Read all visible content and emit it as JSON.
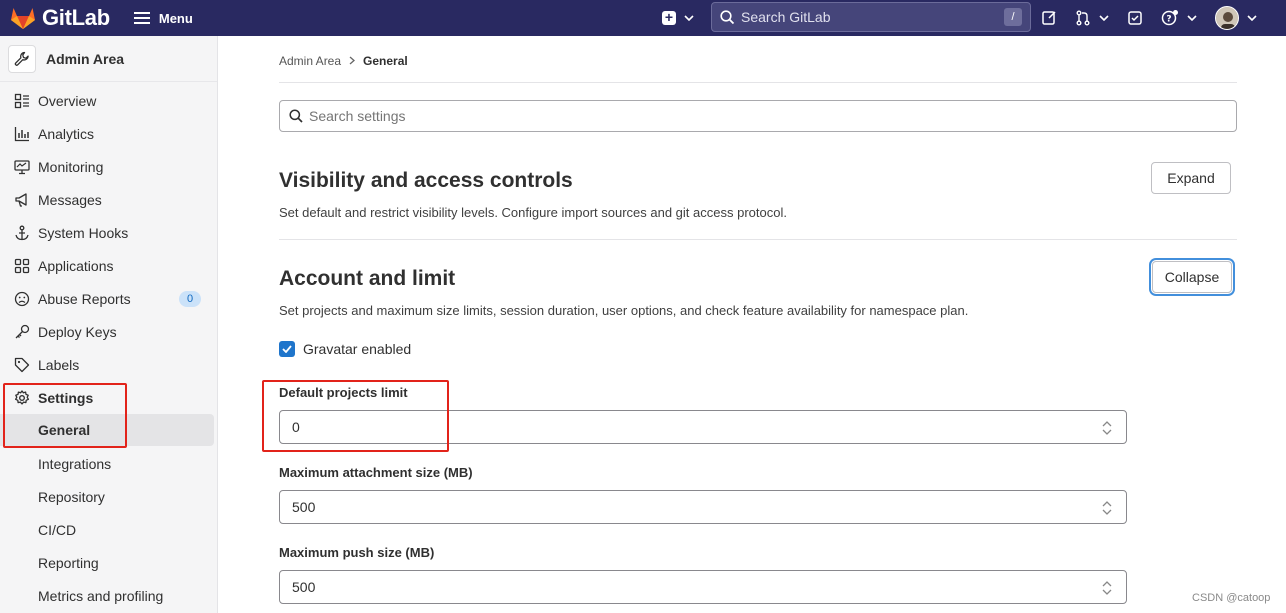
{
  "topbar": {
    "brand": "GitLab",
    "menu_label": "Menu",
    "search_placeholder": "Search GitLab",
    "search_shortcut": "/"
  },
  "sidebar": {
    "context_title": "Admin Area",
    "items": [
      {
        "label": "Overview",
        "icon": "overview-icon"
      },
      {
        "label": "Analytics",
        "icon": "chart-icon"
      },
      {
        "label": "Monitoring",
        "icon": "monitor-icon"
      },
      {
        "label": "Messages",
        "icon": "bullhorn-icon"
      },
      {
        "label": "System Hooks",
        "icon": "anchor-icon"
      },
      {
        "label": "Applications",
        "icon": "applications-icon"
      },
      {
        "label": "Abuse Reports",
        "icon": "abuse-icon",
        "badge": "0"
      },
      {
        "label": "Deploy Keys",
        "icon": "key-icon"
      },
      {
        "label": "Labels",
        "icon": "label-icon"
      },
      {
        "label": "Settings",
        "icon": "settings-icon"
      }
    ],
    "sub_items": [
      {
        "label": "General",
        "active": true
      },
      {
        "label": "Integrations"
      },
      {
        "label": "Repository"
      },
      {
        "label": "CI/CD"
      },
      {
        "label": "Reporting"
      },
      {
        "label": "Metrics and profiling"
      }
    ]
  },
  "breadcrumb": {
    "parent": "Admin Area",
    "current": "General"
  },
  "settings_search": {
    "placeholder": "Search settings"
  },
  "sections": {
    "visibility": {
      "title": "Visibility and access controls",
      "description": "Set default and restrict visibility levels. Configure import sources and git access protocol.",
      "button": "Expand"
    },
    "account": {
      "title": "Account and limit",
      "description": "Set projects and maximum size limits, session duration, user options, and check feature availability for namespace plan.",
      "button": "Collapse",
      "gravatar_label": "Gravatar enabled",
      "gravatar_checked": true,
      "fields": [
        {
          "label": "Default projects limit",
          "value": "0"
        },
        {
          "label": "Maximum attachment size (MB)",
          "value": "500"
        },
        {
          "label": "Maximum push size (MB)",
          "value": "500"
        }
      ]
    }
  },
  "watermark": "CSDN @catoop",
  "colors": {
    "navbar": "#292961",
    "highlight_box": "#e2231a",
    "checkbox": "#1f75cb"
  }
}
